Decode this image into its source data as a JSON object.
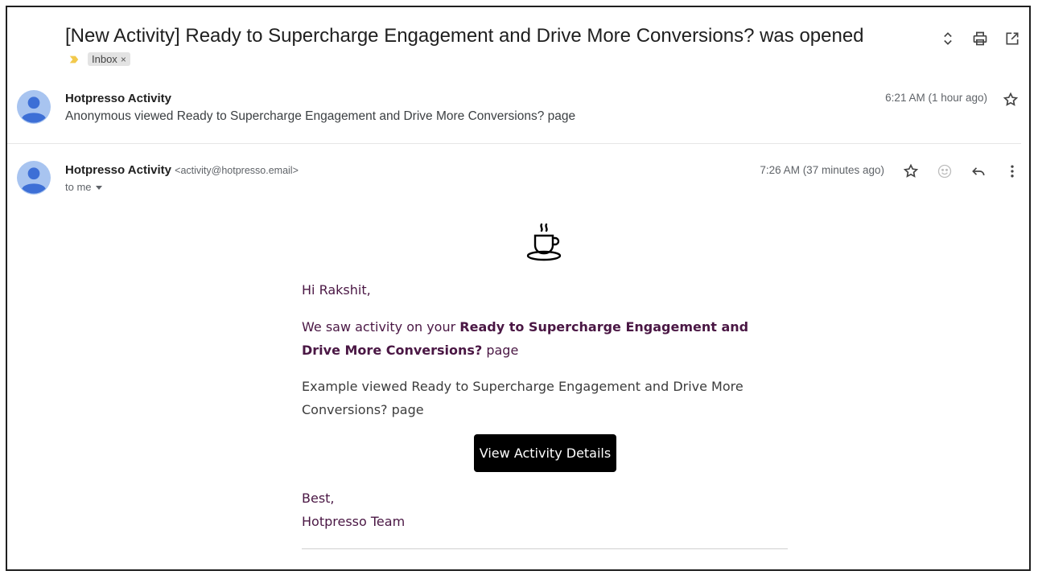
{
  "thread": {
    "subject": "[New Activity] Ready to Supercharge Engagement and Drive More Conversions? was opened",
    "label": "Inbox",
    "label_remove": "×"
  },
  "message1": {
    "sender": "Hotpresso Activity",
    "snippet": "Anonymous viewed Ready to Supercharge Engagement and Drive More Conversions? page",
    "time": "6:21 AM (1 hour ago)"
  },
  "message2": {
    "sender": "Hotpresso Activity",
    "email": "<activity@hotpresso.email>",
    "recipient": "to me",
    "time": "7:26 AM (37 minutes ago)"
  },
  "body": {
    "greeting": "Hi Rakshit,",
    "p1_prefix": "We saw activity on your",
    "p1_bold": "Ready to Supercharge Engagement and Drive More Conversions?",
    "p1_suffix": "page",
    "p2": "Example viewed Ready to Supercharge Engagement and Drive More Conversions? page",
    "cta": "View Activity Details",
    "signoff": "Best,",
    "team": "Hotpresso Team"
  },
  "colors": {
    "brand_text": "#4a1744",
    "avatar": "#7aa2e8",
    "importance": "#f2c94c",
    "cta_bg": "#000000"
  },
  "icons": {
    "expand": "unfold-icon",
    "print": "print-icon",
    "popout": "open-in-new-icon",
    "star": "star-icon",
    "emoji": "smiley-icon",
    "reply": "reply-icon",
    "more": "more-vert-icon",
    "logo": "coffee-cup-icon"
  }
}
